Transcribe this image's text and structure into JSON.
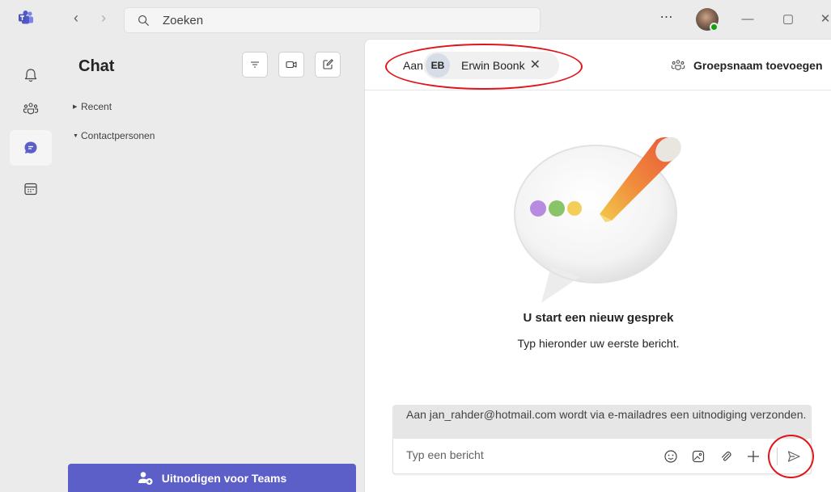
{
  "titlebar": {
    "search_placeholder": "Zoeken",
    "more_label": "⋯"
  },
  "rail": {
    "items": [
      {
        "name": "activity",
        "icon": "bell-icon"
      },
      {
        "name": "teams",
        "icon": "people-group-icon"
      },
      {
        "name": "chat",
        "icon": "chat-icon",
        "active": true
      },
      {
        "name": "calendar",
        "icon": "calendar-icon"
      }
    ]
  },
  "chat_list": {
    "title": "Chat",
    "sections": [
      {
        "label": "Recent",
        "expanded": false
      },
      {
        "label": "Contactpersonen",
        "expanded": true
      }
    ],
    "invite_button": "Uitnodigen voor Teams"
  },
  "conversation": {
    "to_label": "Aan:",
    "recipient": {
      "initials": "EB",
      "name": "Erwin Boonk"
    },
    "group_name_button": "Groepsnaam toevoegen",
    "empty_title": "U start een nieuw gesprek",
    "empty_subtitle": "Typ hieronder uw eerste bericht.",
    "notice": "Aan jan_rahder@hotmail.com wordt via e-mailadres een uitnodiging verzonden.",
    "composer_placeholder": "Typ een bericht"
  },
  "colors": {
    "accent": "#5b5fc7",
    "annotation": "#e0151b",
    "status_available": "#13a10e"
  }
}
